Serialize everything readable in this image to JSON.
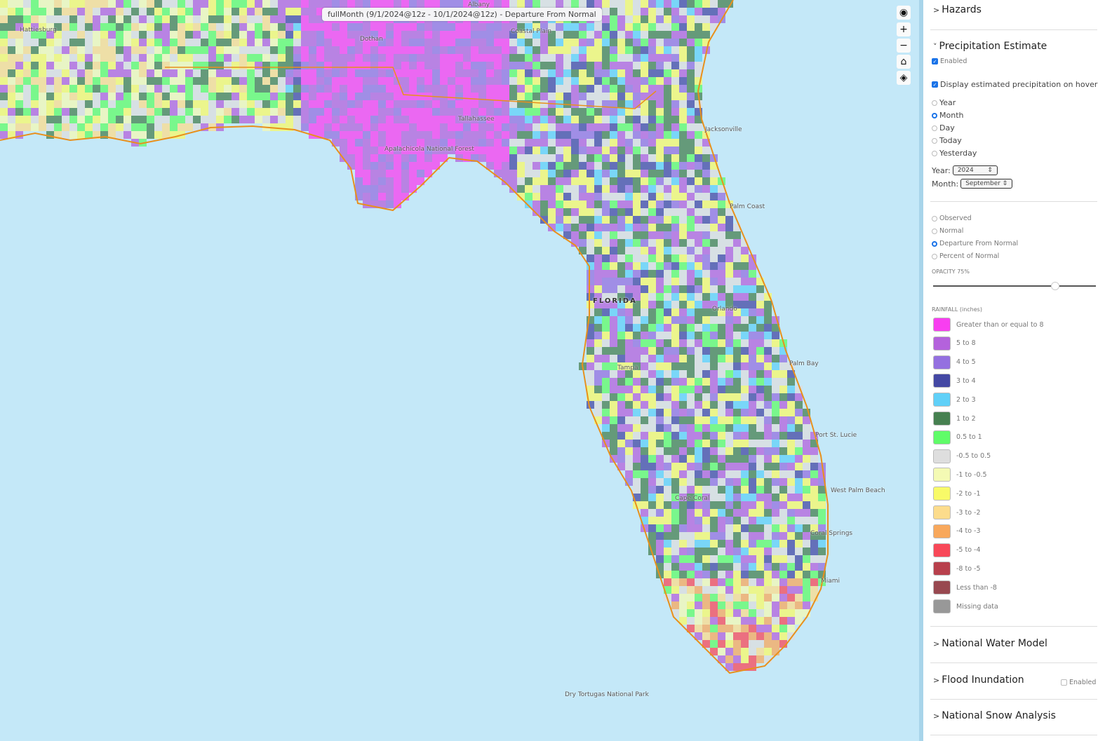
{
  "map": {
    "title": "fullMonth (9/1/2024@12z - 10/1/2024@12z) - Departure From Normal",
    "labels": [
      "Albany",
      "Dothan",
      "Hattiesburg",
      "Coastal Plain",
      "Tallahassee",
      "Apalachicola National Forest",
      "Jacksonville",
      "Palm Coast",
      "FLORIDA",
      "Orlando",
      "Tampa",
      "Palm Bay",
      "Port St. Lucie",
      "West Palm Beach",
      "Cape Coral",
      "Coral Springs",
      "Miami",
      "Dry Tortugas National Park"
    ],
    "controls": {
      "locate": "locate-icon",
      "zoom_in": "+",
      "zoom_out": "−",
      "home": "home-icon",
      "layers": "layers-icon"
    },
    "ocean_color": "#c4e8f8"
  },
  "panel": {
    "hazards": "Hazards",
    "precip": {
      "title": "Precipitation Estimate",
      "enabled": "Enabled",
      "hover": "Display estimated precipitation on hover",
      "periods": [
        {
          "label": "Year",
          "selected": false
        },
        {
          "label": "Month",
          "selected": true
        },
        {
          "label": "Day",
          "selected": false
        },
        {
          "label": "Today",
          "selected": false
        },
        {
          "label": "Yesterday",
          "selected": false
        }
      ],
      "year_label": "Year:",
      "year_value": "2024",
      "month_label": "Month:",
      "month_value": "September",
      "modes": [
        {
          "label": "Observed",
          "selected": false
        },
        {
          "label": "Normal",
          "selected": false
        },
        {
          "label": "Departure From Normal",
          "selected": true
        },
        {
          "label": "Percent of Normal",
          "selected": false
        }
      ],
      "opacity_label": "OPACITY 75%",
      "opacity": 0.75,
      "legend_title": "RAINFALL (inches)",
      "legend": [
        {
          "label": "Greater than or equal to 8",
          "color": "#f83ef0"
        },
        {
          "label": "5 to 8",
          "color": "#b462dc"
        },
        {
          "label": "4 to 5",
          "color": "#9470e0"
        },
        {
          "label": "3 to 4",
          "color": "#4448a4"
        },
        {
          "label": "2 to 3",
          "color": "#60d0f8"
        },
        {
          "label": "1 to 2",
          "color": "#468050"
        },
        {
          "label": "0.5 to 1",
          "color": "#60fc68"
        },
        {
          "label": "-0.5 to 0.5",
          "color": "#dedede"
        },
        {
          "label": "-1 to -0.5",
          "color": "#f4fab4"
        },
        {
          "label": "-2 to -1",
          "color": "#f8fa68"
        },
        {
          "label": "-3 to -2",
          "color": "#fcdc8c"
        },
        {
          "label": "-4 to -3",
          "color": "#f8a85c"
        },
        {
          "label": "-5 to -4",
          "color": "#f84858"
        },
        {
          "label": "-8 to -5",
          "color": "#b8404c"
        },
        {
          "label": "Less than -8",
          "color": "#984850"
        },
        {
          "label": "Missing data",
          "color": "#989898"
        }
      ]
    },
    "nwm": "National Water Model",
    "flood": "Flood Inundation",
    "flood_enabled": "Enabled",
    "snow": "National Snow Analysis"
  }
}
